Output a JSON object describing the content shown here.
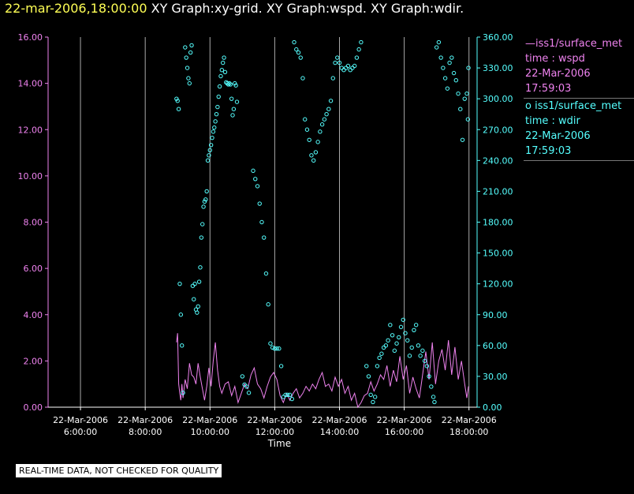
{
  "header": {
    "timestamp": "22-mar-2006,18:00:00",
    "graphs": " XY Graph:xy-grid.  XY Graph:wspd.  XY Graph:wdir."
  },
  "legend": {
    "wspd": {
      "line1": "iss1/surface_met",
      "line2": "time : wspd",
      "line3": "22-Mar-2006",
      "line4": "17:59:03"
    },
    "wdir": {
      "line1": "iss1/surface_met",
      "line2": "time : wdir",
      "line3": "22-Mar-2006",
      "line4": "17:59:03"
    }
  },
  "footer_note": "REAL-TIME DATA, NOT CHECKED FOR QUALITY",
  "colors": {
    "background": "#000000",
    "wspd": "#ee82ee",
    "wdir": "#55ffff",
    "title": "#ffff55",
    "grid": "#aaaaaa"
  },
  "chart_data": {
    "type": "line",
    "title": "",
    "xlabel": "Time",
    "xlim": [
      "22-Mar-2006 05:00",
      "22-Mar-2006 18:15"
    ],
    "x_ticks": [
      {
        "date": "22-Mar-2006",
        "time": "6:00:00"
      },
      {
        "date": "22-Mar-2006",
        "time": "8:00:00"
      },
      {
        "date": "22-Mar-2006",
        "time": "10:00:00"
      },
      {
        "date": "22-Mar-2006",
        "time": "12:00:00"
      },
      {
        "date": "22-Mar-2006",
        "time": "14:00:00"
      },
      {
        "date": "22-Mar-2006",
        "time": "16:00:00"
      },
      {
        "date": "22-Mar-2006",
        "time": "18:00:00"
      }
    ],
    "grid": true,
    "axes": {
      "left": {
        "ylim": [
          0,
          16
        ],
        "ticks": [
          "0.00",
          "2.00",
          "4.00",
          "6.00",
          "8.00",
          "10.00",
          "12.00",
          "14.00",
          "16.00"
        ]
      },
      "right": {
        "ylim": [
          0,
          360
        ],
        "ticks": [
          "0.00",
          "30.00",
          "60.00",
          "90.00",
          "120.00",
          "150.00",
          "180.00",
          "210.00",
          "240.00",
          "270.00",
          "300.00",
          "330.00",
          "360.00"
        ]
      }
    },
    "series": [
      {
        "name": "iss1/surface_met time : wspd",
        "axis": "left",
        "style": "line",
        "points": [
          [
            "08:58",
            2.8
          ],
          [
            "09:00",
            3.2
          ],
          [
            "09:02",
            1.0
          ],
          [
            "09:04",
            0.6
          ],
          [
            "09:06",
            0.3
          ],
          [
            "09:08",
            1.0
          ],
          [
            "09:10",
            0.4
          ],
          [
            "09:14",
            1.2
          ],
          [
            "09:18",
            0.8
          ],
          [
            "09:22",
            1.9
          ],
          [
            "09:26",
            1.4
          ],
          [
            "09:30",
            1.3
          ],
          [
            "09:34",
            1.0
          ],
          [
            "09:38",
            1.9
          ],
          [
            "09:42",
            1.3
          ],
          [
            "09:46",
            0.8
          ],
          [
            "09:50",
            0.3
          ],
          [
            "09:54",
            0.9
          ],
          [
            "09:58",
            1.7
          ],
          [
            "10:02",
            0.9
          ],
          [
            "10:06",
            2.0
          ],
          [
            "10:10",
            2.8
          ],
          [
            "10:14",
            1.6
          ],
          [
            "10:18",
            0.9
          ],
          [
            "10:22",
            0.6
          ],
          [
            "10:28",
            1.0
          ],
          [
            "10:34",
            1.1
          ],
          [
            "10:40",
            0.5
          ],
          [
            "10:46",
            0.9
          ],
          [
            "10:52",
            0.2
          ],
          [
            "10:58",
            0.6
          ],
          [
            "11:04",
            1.0
          ],
          [
            "11:10",
            0.8
          ],
          [
            "11:16",
            1.4
          ],
          [
            "11:22",
            1.7
          ],
          [
            "11:28",
            1.0
          ],
          [
            "11:34",
            0.8
          ],
          [
            "11:40",
            0.4
          ],
          [
            "11:46",
            0.9
          ],
          [
            "11:52",
            1.3
          ],
          [
            "11:58",
            1.5
          ],
          [
            "12:04",
            1.2
          ],
          [
            "12:10",
            0.5
          ],
          [
            "12:16",
            0.2
          ],
          [
            "12:22",
            0.6
          ],
          [
            "12:28",
            0.3
          ],
          [
            "12:34",
            0.6
          ],
          [
            "12:40",
            0.8
          ],
          [
            "12:46",
            0.4
          ],
          [
            "12:52",
            0.6
          ],
          [
            "12:58",
            0.9
          ],
          [
            "13:04",
            0.7
          ],
          [
            "13:10",
            1.0
          ],
          [
            "13:16",
            0.8
          ],
          [
            "13:22",
            1.2
          ],
          [
            "13:28",
            1.5
          ],
          [
            "13:34",
            0.9
          ],
          [
            "13:40",
            1.0
          ],
          [
            "13:46",
            0.7
          ],
          [
            "13:52",
            1.3
          ],
          [
            "13:58",
            0.9
          ],
          [
            "14:04",
            1.2
          ],
          [
            "14:10",
            0.6
          ],
          [
            "14:16",
            0.9
          ],
          [
            "14:22",
            0.3
          ],
          [
            "14:28",
            0.6
          ],
          [
            "14:34",
            0.0
          ],
          [
            "14:40",
            0.2
          ],
          [
            "14:46",
            0.5
          ],
          [
            "14:52",
            0.6
          ],
          [
            "14:58",
            1.1
          ],
          [
            "15:04",
            0.7
          ],
          [
            "15:10",
            1.0
          ],
          [
            "15:16",
            1.4
          ],
          [
            "15:22",
            1.2
          ],
          [
            "15:28",
            1.8
          ],
          [
            "15:34",
            0.9
          ],
          [
            "15:40",
            1.6
          ],
          [
            "15:46",
            1.1
          ],
          [
            "15:52",
            2.2
          ],
          [
            "15:58",
            1.2
          ],
          [
            "16:04",
            1.8
          ],
          [
            "16:10",
            0.6
          ],
          [
            "16:16",
            1.3
          ],
          [
            "16:22",
            0.8
          ],
          [
            "16:28",
            0.4
          ],
          [
            "16:34",
            1.4
          ],
          [
            "16:40",
            2.4
          ],
          [
            "16:46",
            1.2
          ],
          [
            "16:52",
            2.8
          ],
          [
            "16:58",
            1.0
          ],
          [
            "17:04",
            2.0
          ],
          [
            "17:10",
            2.5
          ],
          [
            "17:16",
            1.6
          ],
          [
            "17:22",
            2.9
          ],
          [
            "17:28",
            1.4
          ],
          [
            "17:34",
            2.6
          ],
          [
            "17:40",
            1.2
          ],
          [
            "17:46",
            2.0
          ],
          [
            "17:52",
            1.0
          ],
          [
            "17:56",
            0.4
          ],
          [
            "17:59",
            0.9
          ]
        ]
      },
      {
        "name": "iss1/surface_met time : wdir",
        "axis": "right",
        "style": "scatter",
        "points": [
          [
            "08:58",
            300
          ],
          [
            "09:00",
            298
          ],
          [
            "09:02",
            290
          ],
          [
            "09:04",
            120
          ],
          [
            "09:06",
            90
          ],
          [
            "09:08",
            60
          ],
          [
            "09:10",
            14
          ],
          [
            "09:14",
            350
          ],
          [
            "09:16",
            340
          ],
          [
            "09:18",
            330
          ],
          [
            "09:20",
            320
          ],
          [
            "09:22",
            315
          ],
          [
            "09:24",
            345
          ],
          [
            "09:26",
            352
          ],
          [
            "09:28",
            118
          ],
          [
            "09:30",
            105
          ],
          [
            "09:32",
            120
          ],
          [
            "09:34",
            95
          ],
          [
            "09:36",
            92
          ],
          [
            "09:38",
            98
          ],
          [
            "09:40",
            122
          ],
          [
            "09:42",
            136
          ],
          [
            "09:44",
            165
          ],
          [
            "09:46",
            178
          ],
          [
            "09:48",
            195
          ],
          [
            "09:50",
            200
          ],
          [
            "09:52",
            202
          ],
          [
            "09:54",
            210
          ],
          [
            "09:56",
            240
          ],
          [
            "09:58",
            245
          ],
          [
            "10:00",
            250
          ],
          [
            "10:02",
            255
          ],
          [
            "10:04",
            262
          ],
          [
            "10:06",
            268
          ],
          [
            "10:08",
            272
          ],
          [
            "10:10",
            278
          ],
          [
            "10:12",
            285
          ],
          [
            "10:14",
            292
          ],
          [
            "10:16",
            302
          ],
          [
            "10:18",
            312
          ],
          [
            "10:20",
            322
          ],
          [
            "10:22",
            328
          ],
          [
            "10:24",
            335
          ],
          [
            "10:26",
            340
          ],
          [
            "10:28",
            326
          ],
          [
            "10:30",
            316
          ],
          [
            "10:32",
            315
          ],
          [
            "10:34",
            314
          ],
          [
            "10:36",
            315
          ],
          [
            "10:38",
            314
          ],
          [
            "10:40",
            300
          ],
          [
            "10:42",
            284
          ],
          [
            "10:44",
            290
          ],
          [
            "10:46",
            315
          ],
          [
            "10:48",
            313
          ],
          [
            "10:50",
            297
          ],
          [
            "11:00",
            30
          ],
          [
            "11:04",
            22
          ],
          [
            "11:08",
            20
          ],
          [
            "11:12",
            14
          ],
          [
            "11:20",
            230
          ],
          [
            "11:24",
            222
          ],
          [
            "11:28",
            215
          ],
          [
            "11:32",
            198
          ],
          [
            "11:36",
            180
          ],
          [
            "11:40",
            165
          ],
          [
            "11:44",
            130
          ],
          [
            "11:48",
            100
          ],
          [
            "11:52",
            62
          ],
          [
            "11:56",
            58
          ],
          [
            "12:00",
            57
          ],
          [
            "12:04",
            57
          ],
          [
            "12:08",
            57
          ],
          [
            "12:12",
            40
          ],
          [
            "12:16",
            10
          ],
          [
            "12:20",
            12
          ],
          [
            "12:24",
            12
          ],
          [
            "12:28",
            12
          ],
          [
            "12:32",
            8
          ],
          [
            "12:36",
            355
          ],
          [
            "12:40",
            348
          ],
          [
            "12:44",
            345
          ],
          [
            "12:48",
            340
          ],
          [
            "12:52",
            320
          ],
          [
            "12:56",
            280
          ],
          [
            "13:00",
            270
          ],
          [
            "13:04",
            260
          ],
          [
            "13:08",
            245
          ],
          [
            "13:12",
            240
          ],
          [
            "13:16",
            248
          ],
          [
            "13:20",
            258
          ],
          [
            "13:24",
            268
          ],
          [
            "13:28",
            275
          ],
          [
            "13:32",
            280
          ],
          [
            "13:36",
            285
          ],
          [
            "13:40",
            290
          ],
          [
            "13:44",
            298
          ],
          [
            "13:48",
            320
          ],
          [
            "13:52",
            335
          ],
          [
            "13:56",
            340
          ],
          [
            "14:00",
            335
          ],
          [
            "14:04",
            330
          ],
          [
            "14:08",
            328
          ],
          [
            "14:12",
            330
          ],
          [
            "14:16",
            332
          ],
          [
            "14:20",
            328
          ],
          [
            "14:24",
            330
          ],
          [
            "14:28",
            332
          ],
          [
            "14:32",
            340
          ],
          [
            "14:36",
            348
          ],
          [
            "14:40",
            355
          ],
          [
            "14:50",
            40
          ],
          [
            "14:54",
            30
          ],
          [
            "14:58",
            12
          ],
          [
            "15:02",
            5
          ],
          [
            "15:06",
            10
          ],
          [
            "15:10",
            40
          ],
          [
            "15:14",
            48
          ],
          [
            "15:18",
            52
          ],
          [
            "15:22",
            58
          ],
          [
            "15:26",
            60
          ],
          [
            "15:30",
            65
          ],
          [
            "15:34",
            80
          ],
          [
            "15:38",
            70
          ],
          [
            "15:42",
            55
          ],
          [
            "15:46",
            62
          ],
          [
            "15:50",
            68
          ],
          [
            "15:54",
            78
          ],
          [
            "15:58",
            85
          ],
          [
            "16:02",
            72
          ],
          [
            "16:06",
            65
          ],
          [
            "16:10",
            50
          ],
          [
            "16:14",
            58
          ],
          [
            "16:18",
            75
          ],
          [
            "16:22",
            80
          ],
          [
            "16:26",
            60
          ],
          [
            "16:30",
            50
          ],
          [
            "16:34",
            55
          ],
          [
            "16:38",
            45
          ],
          [
            "16:42",
            40
          ],
          [
            "16:46",
            30
          ],
          [
            "16:50",
            20
          ],
          [
            "16:54",
            10
          ],
          [
            "16:56",
            5
          ],
          [
            "17:00",
            350
          ],
          [
            "17:04",
            355
          ],
          [
            "17:08",
            340
          ],
          [
            "17:12",
            330
          ],
          [
            "17:16",
            320
          ],
          [
            "17:20",
            310
          ],
          [
            "17:24",
            335
          ],
          [
            "17:28",
            340
          ],
          [
            "17:32",
            325
          ],
          [
            "17:36",
            318
          ],
          [
            "17:40",
            305
          ],
          [
            "17:44",
            290
          ],
          [
            "17:48",
            260
          ],
          [
            "17:52",
            300
          ],
          [
            "17:56",
            305
          ],
          [
            "17:58",
            280
          ],
          [
            "17:59",
            330
          ]
        ]
      }
    ]
  }
}
